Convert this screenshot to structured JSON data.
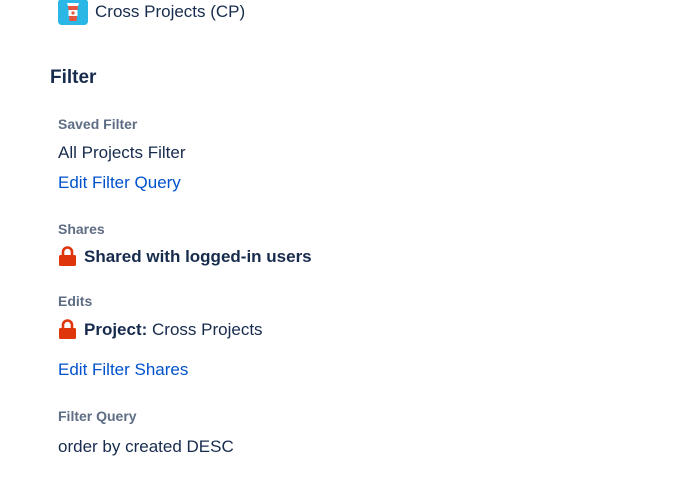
{
  "project": {
    "name": "Cross Projects (CP)",
    "avatar_color": "#2bb7e6",
    "avatar_icon": "coffee-cup-icon"
  },
  "filter": {
    "section_title": "Filter",
    "saved_filter": {
      "label": "Saved Filter",
      "value": "All Projects Filter",
      "edit_link": "Edit Filter Query"
    },
    "shares": {
      "label": "Shares",
      "icon": "lock-icon",
      "value": "Shared with logged-in users"
    },
    "edits": {
      "label": "Edits",
      "icon": "lock-icon",
      "prefix": "Project:",
      "value": "Cross Projects",
      "edit_link": "Edit Filter Shares"
    },
    "query": {
      "label": "Filter Query",
      "value": "order by created DESC"
    }
  },
  "colors": {
    "link": "#0052cc",
    "lock": "#de350b",
    "heading": "#172b4d",
    "label": "#5e6c84"
  }
}
